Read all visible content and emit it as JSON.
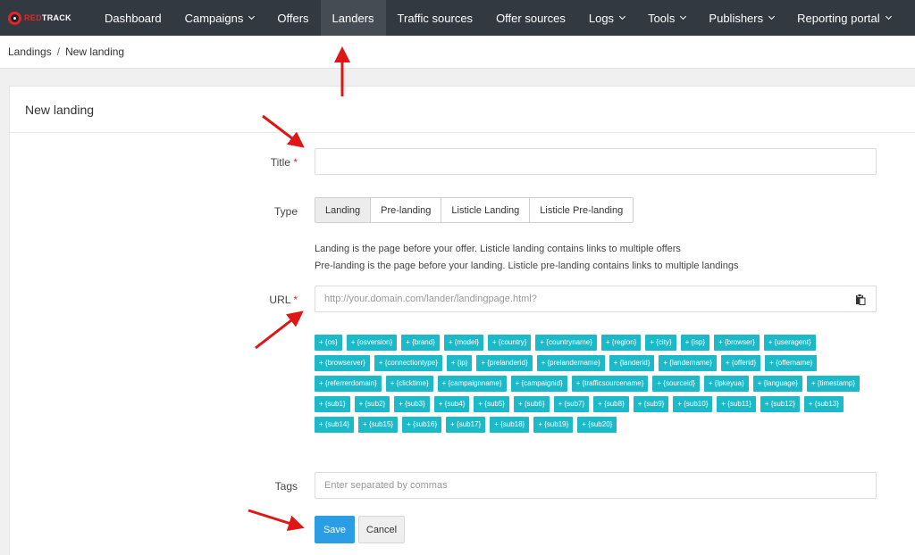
{
  "brand": {
    "logo_text_red": "RED",
    "logo_text_white": "TRACK"
  },
  "nav": {
    "items": [
      {
        "label": "Dashboard",
        "dropdown": false,
        "active": false
      },
      {
        "label": "Campaigns",
        "dropdown": true,
        "active": false
      },
      {
        "label": "Offers",
        "dropdown": false,
        "active": false
      },
      {
        "label": "Landers",
        "dropdown": false,
        "active": true
      },
      {
        "label": "Traffic sources",
        "dropdown": false,
        "active": false
      },
      {
        "label": "Offer sources",
        "dropdown": false,
        "active": false
      },
      {
        "label": "Logs",
        "dropdown": true,
        "active": false
      },
      {
        "label": "Tools",
        "dropdown": true,
        "active": false
      },
      {
        "label": "Publishers",
        "dropdown": true,
        "active": false
      },
      {
        "label": "Reporting portal",
        "dropdown": true,
        "active": false
      }
    ]
  },
  "breadcrumb": {
    "parent": "Landings",
    "separator": "/",
    "current": "New landing"
  },
  "form": {
    "header": "New landing",
    "title_label": "Title",
    "required_mark": "*",
    "title_value": "",
    "type_label": "Type",
    "type_options": [
      "Landing",
      "Pre-landing",
      "Listicle Landing",
      "Listicle Pre-landing"
    ],
    "type_selected": "Landing",
    "help_line1": "Landing is the page before your offer. Listicle landing contains links to multiple offers",
    "help_line2": "Pre-landing is the page before your landing. Listicle pre-landing contains links to multiple landings",
    "url_label": "URL",
    "url_placeholder": "http://your.domain.com/lander/landingpage.html?",
    "copy_icon": "clipboard-icon",
    "macros": [
      "+ {os}",
      "+ {osversion}",
      "+ {brand}",
      "+ {model}",
      "+ {country}",
      "+ {countryname}",
      "+ {region}",
      "+ {city}",
      "+ {isp}",
      "+ {browser}",
      "+ {useragent}",
      "+ {browserver}",
      "+ {connectiontype}",
      "+ {ip}",
      "+ {prelanderid}",
      "+ {prelandername}",
      "+ {landerid}",
      "+ {landername}",
      "+ {offerid}",
      "+ {offername}",
      "+ {referrerdomain}",
      "+ {clicktime}",
      "+ {campaignname}",
      "+ {campaignid}",
      "+ {trafficsourcename}",
      "+ {sourceid}",
      "+ {lpkeyua}",
      "+ {language}",
      "+ {timestamp}",
      "+ {sub1}",
      "+ {sub2}",
      "+ {sub3}",
      "+ {sub4}",
      "+ {sub5}",
      "+ {sub6}",
      "+ {sub7}",
      "+ {sub8}",
      "+ {sub9}",
      "+ {sub10}",
      "+ {sub11}",
      "+ {sub12}",
      "+ {sub13}",
      "+ {sub14}",
      "+ {sub15}",
      "+ {sub16}",
      "+ {sub17}",
      "+ {sub18}",
      "+ {sub19}",
      "+ {sub20}"
    ],
    "tags_label": "Tags",
    "tags_placeholder": "Enter separated by commas",
    "save_label": "Save",
    "cancel_label": "Cancel"
  },
  "colors": {
    "topnav_bg": "#323941",
    "brand_red": "#e4242b",
    "macro_bg": "#1cb9c8",
    "save_bg": "#2a9de5",
    "annotation_arrow": "#e01616"
  }
}
